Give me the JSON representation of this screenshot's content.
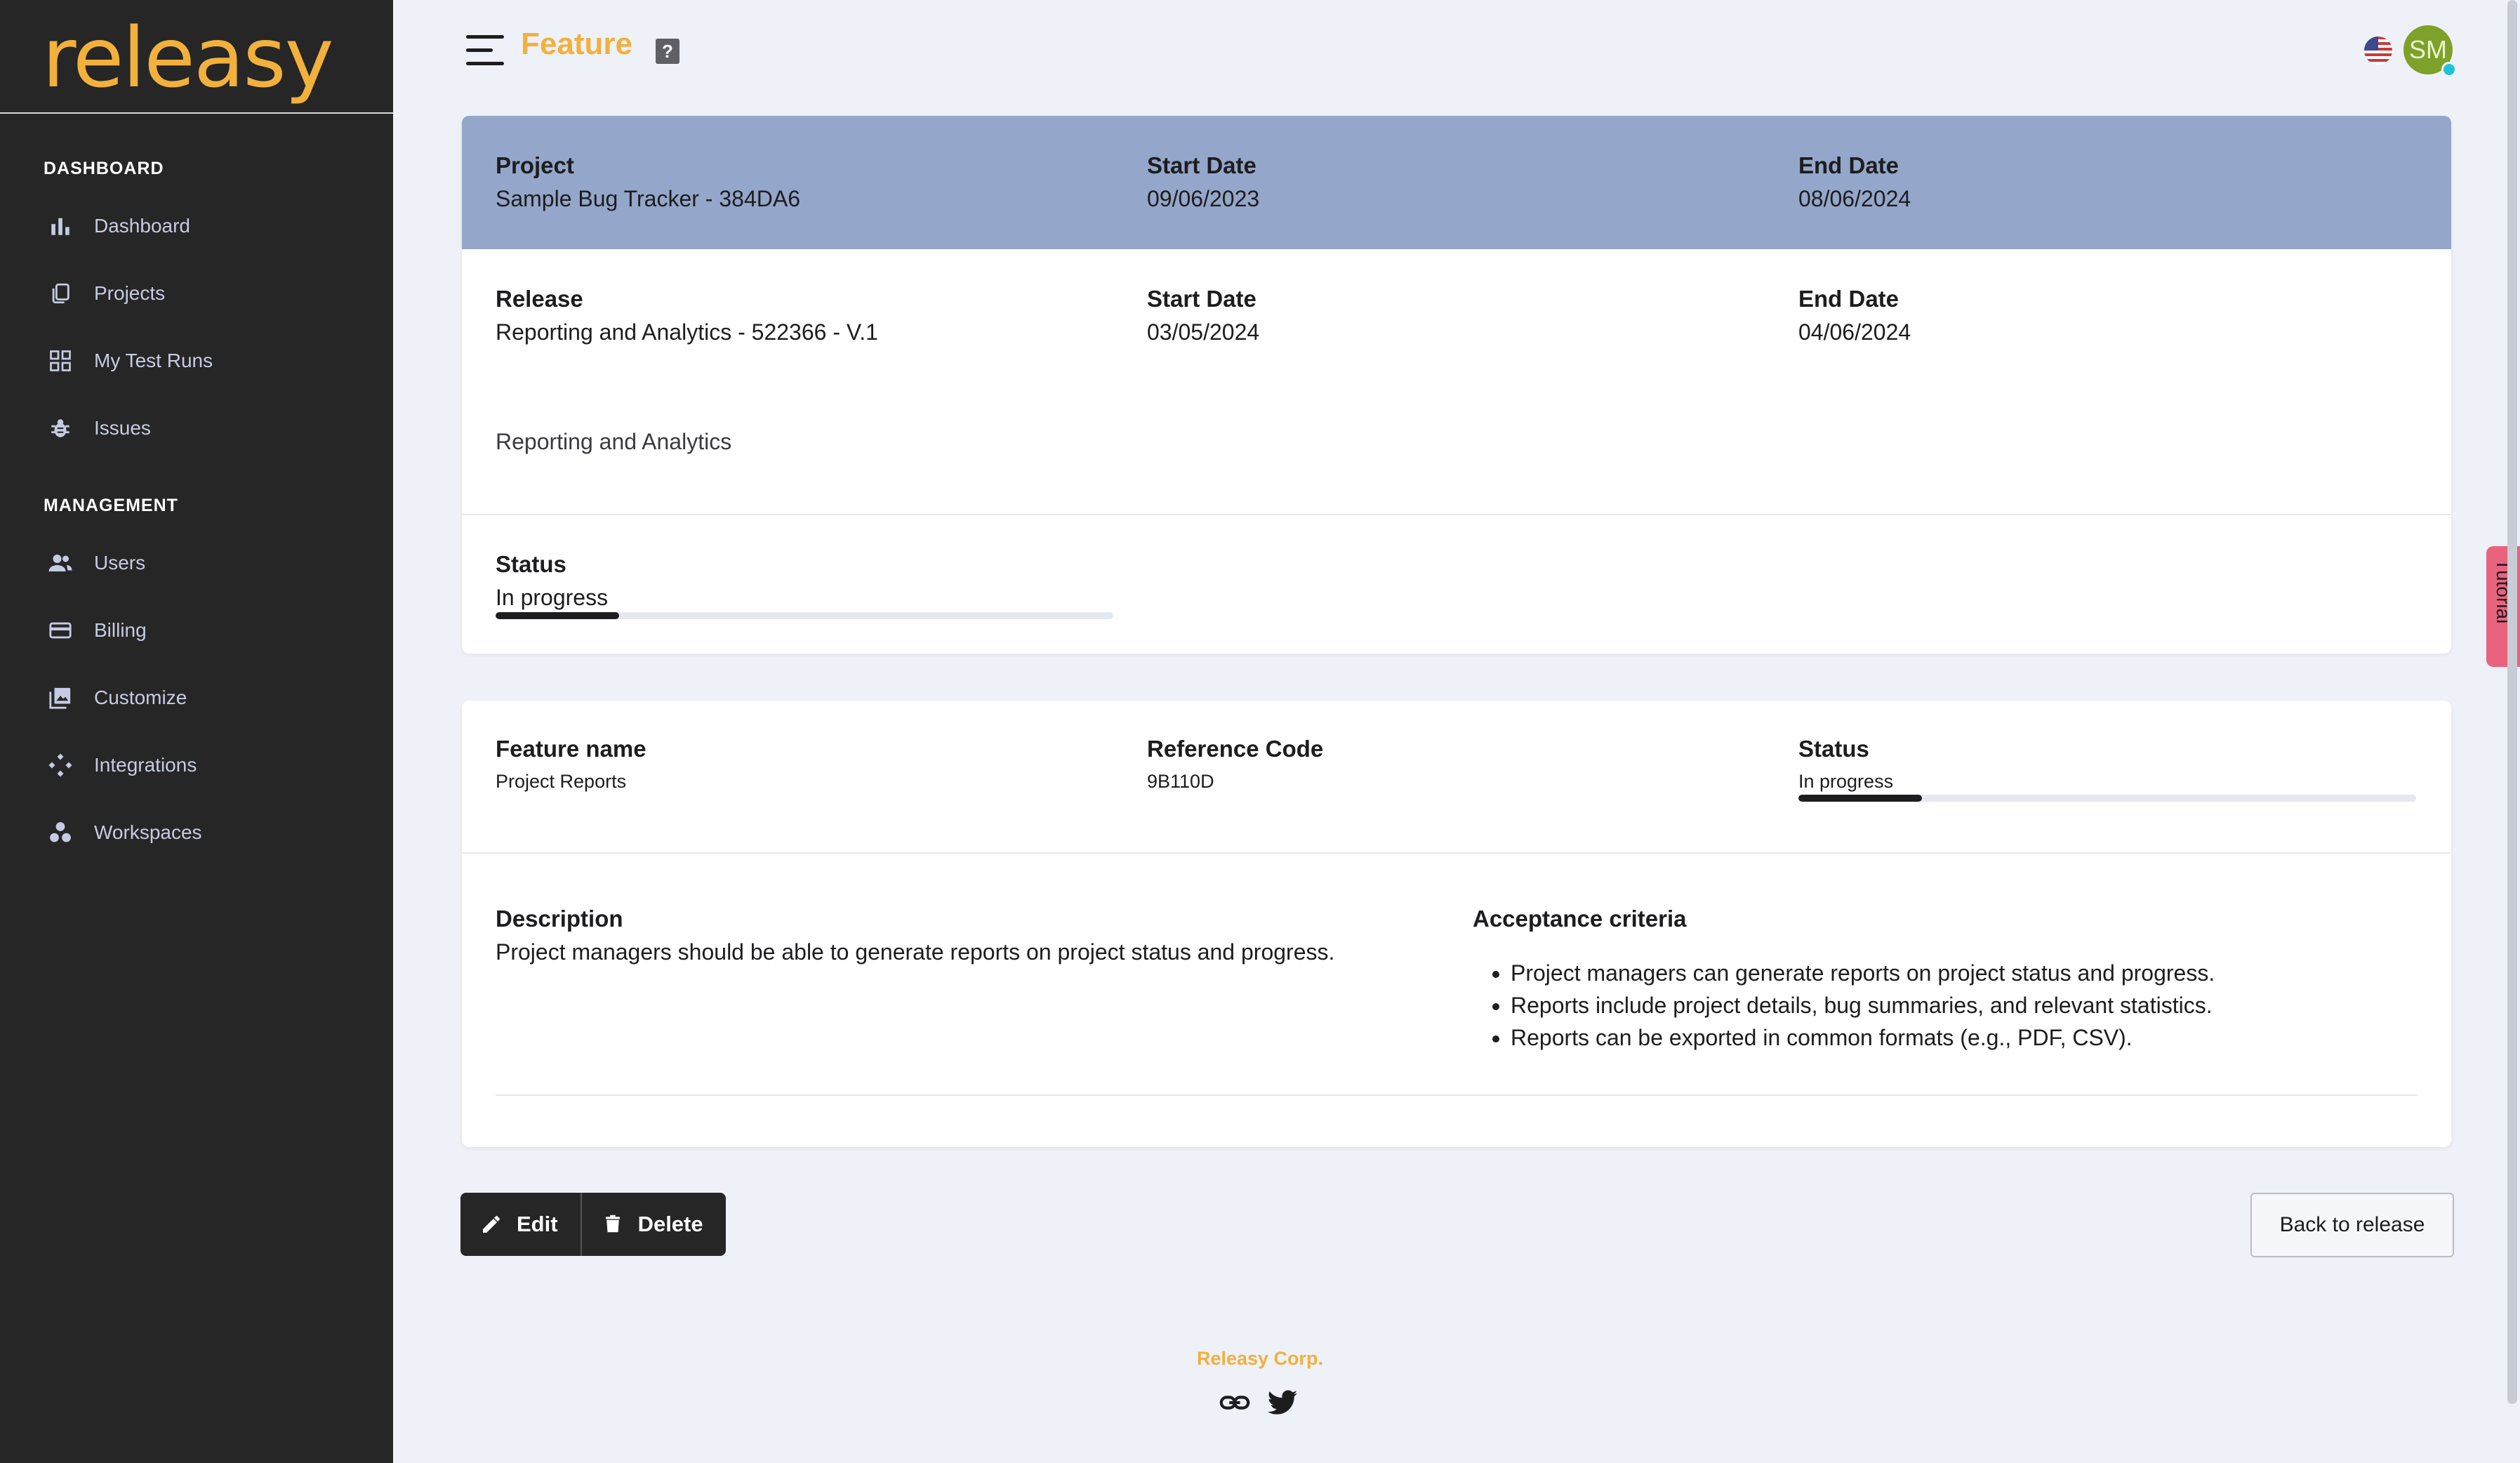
{
  "app": {
    "logo": "releasy",
    "page_title": "Feature",
    "help_badge": "?",
    "avatar_initials": "SM"
  },
  "sidebar": {
    "sections": [
      {
        "title": "DASHBOARD",
        "items": [
          {
            "label": "Dashboard",
            "icon": "bar-chart-icon"
          },
          {
            "label": "Projects",
            "icon": "copy-icon"
          },
          {
            "label": "My Test Runs",
            "icon": "grid-icon"
          },
          {
            "label": "Issues",
            "icon": "bug-icon"
          }
        ]
      },
      {
        "title": "MANAGEMENT",
        "items": [
          {
            "label": "Users",
            "icon": "users-icon"
          },
          {
            "label": "Billing",
            "icon": "credit-card-icon"
          },
          {
            "label": "Customize",
            "icon": "image-gallery-icon"
          },
          {
            "label": "Integrations",
            "icon": "integrations-icon"
          },
          {
            "label": "Workspaces",
            "icon": "workspaces-icon"
          }
        ]
      }
    ]
  },
  "project": {
    "label": "Project",
    "value": "Sample Bug Tracker - 384DA6",
    "start_label": "Start Date",
    "start": "09/06/2023",
    "end_label": "End Date",
    "end": "08/06/2024"
  },
  "release": {
    "label": "Release",
    "value": "Reporting and Analytics - 522366 - V.1",
    "start_label": "Start Date",
    "start": "03/05/2024",
    "end_label": "End Date",
    "end": "04/06/2024",
    "description": "Reporting and Analytics",
    "status_label": "Status",
    "status": "In progress",
    "progress": 0.2
  },
  "feature": {
    "name_label": "Feature name",
    "name": "Project Reports",
    "ref_label": "Reference Code",
    "ref": "9B110D",
    "status_label": "Status",
    "status": "In progress",
    "progress": 0.2,
    "description_label": "Description",
    "description": "Project managers should be able to generate reports on project status and progress.",
    "acceptance_label": "Acceptance criteria",
    "acceptance": [
      "Project managers can generate reports on project status and progress.",
      "Reports include project details, bug summaries, and relevant statistics.",
      "Reports can be exported in common formats (e.g., PDF, CSV)."
    ]
  },
  "actions": {
    "edit": "Edit",
    "delete": "Delete",
    "back": "Back to release"
  },
  "footer": {
    "brand": "Releasy Corp."
  },
  "tutorial": {
    "label": "Tutorial"
  },
  "colors": {
    "accent": "#f2b03d",
    "sidebar": "#262626",
    "project_header": "#94a6c9",
    "tutorial": "#e9637f"
  }
}
